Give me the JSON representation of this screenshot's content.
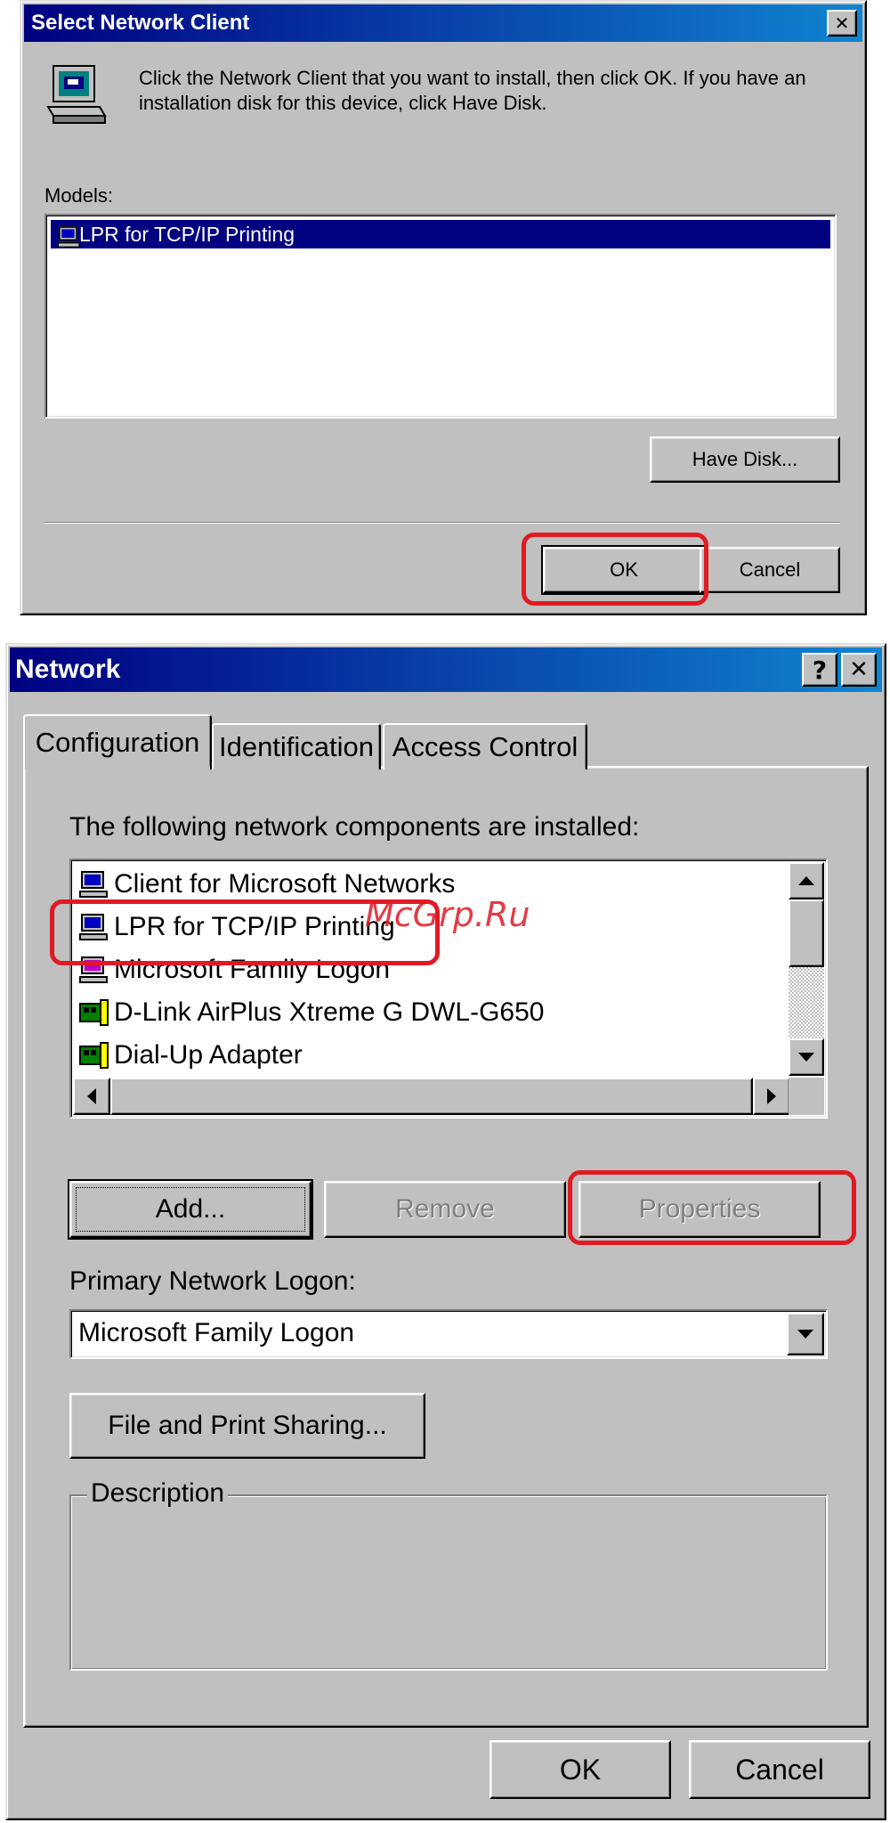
{
  "select_dialog": {
    "title": "Select Network Client",
    "close_glyph": "✕",
    "instruction": "Click the Network Client that you want to install, then click OK. If you have an installation disk for this device, click Have Disk.",
    "models_label": "Models:",
    "models": [
      "LPR for TCP/IP Printing"
    ],
    "have_disk_label": "Have Disk...",
    "ok_label": "OK",
    "cancel_label": "Cancel"
  },
  "network_dialog": {
    "title": "Network",
    "help_glyph": "?",
    "close_glyph": "✕",
    "tabs": [
      "Configuration",
      "Identification",
      "Access Control"
    ],
    "active_tab": "Configuration",
    "components_label": "The following network components are installed:",
    "components": [
      {
        "label": "Client for Microsoft Networks",
        "icon": "computer-icon"
      },
      {
        "label": "LPR for TCP/IP Printing",
        "icon": "computer-icon"
      },
      {
        "label": "Microsoft Family Logon",
        "icon": "computer-icon"
      },
      {
        "label": "D-Link AirPlus Xtreme G DWL-G650",
        "icon": "network-card-icon"
      },
      {
        "label": "Dial-Up Adapter",
        "icon": "network-card-icon"
      }
    ],
    "add_label": "Add...",
    "remove_label": "Remove",
    "properties_label": "Properties",
    "primary_logon_label": "Primary Network Logon:",
    "primary_logon_value": "Microsoft Family Logon",
    "file_print_label": "File and Print Sharing...",
    "description_label": "Description",
    "ok_label": "OK",
    "cancel_label": "Cancel"
  },
  "watermark": "McGrp.Ru",
  "colors": {
    "highlight": "#e01a24",
    "title_bar": "#000080",
    "face": "#c0c0c0"
  }
}
